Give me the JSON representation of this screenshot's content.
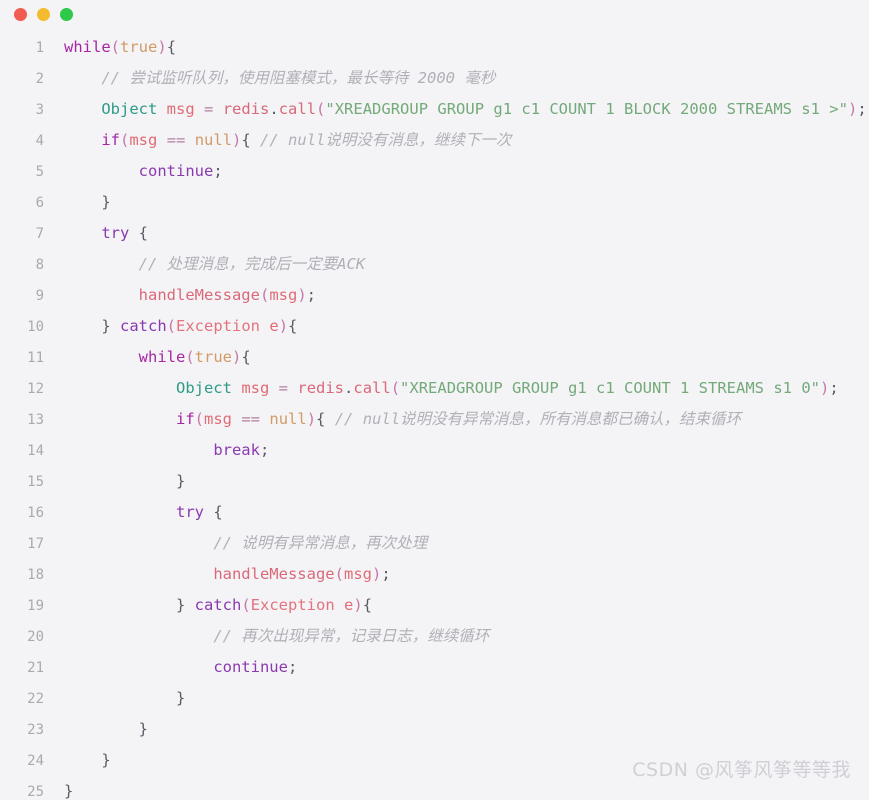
{
  "window": {
    "background_color": "#f4f4f6",
    "traffic_lights": [
      {
        "name": "close",
        "color": "#f05c51"
      },
      {
        "name": "minimize",
        "color": "#f5bb2e"
      },
      {
        "name": "maximize",
        "color": "#2ec84a"
      }
    ]
  },
  "watermark": {
    "text": "CSDN @风筝风筝等等我"
  },
  "code": {
    "language": "java",
    "line_numbers": [
      "1",
      "2",
      "3",
      "4",
      "5",
      "6",
      "7",
      "8",
      "9",
      "10",
      "11",
      "12",
      "13",
      "14",
      "15",
      "16",
      "17",
      "18",
      "19",
      "20",
      "21",
      "22",
      "23",
      "24",
      "25"
    ],
    "lines": [
      {
        "n": "1",
        "text": "while(true){"
      },
      {
        "n": "2",
        "text": "    // 尝试监听队列，使用阻塞模式，最长等待 2000 毫秒"
      },
      {
        "n": "3",
        "text": "    Object msg = redis.call(\"XREADGROUP GROUP g1 c1 COUNT 1 BLOCK 2000 STREAMS s1 >\");"
      },
      {
        "n": "4",
        "text": "    if(msg == null){ // null说明没有消息，继续下一次"
      },
      {
        "n": "5",
        "text": "        continue;"
      },
      {
        "n": "6",
        "text": "    }"
      },
      {
        "n": "7",
        "text": "    try {"
      },
      {
        "n": "8",
        "text": "        // 处理消息，完成后一定要ACK"
      },
      {
        "n": "9",
        "text": "        handleMessage(msg);"
      },
      {
        "n": "10",
        "text": "    } catch(Exception e){"
      },
      {
        "n": "11",
        "text": "        while(true){"
      },
      {
        "n": "12",
        "text": "            Object msg = redis.call(\"XREADGROUP GROUP g1 c1 COUNT 1 STREAMS s1 0\");"
      },
      {
        "n": "13",
        "text": "            if(msg == null){ // null说明没有异常消息，所有消息都已确认，结束循环"
      },
      {
        "n": "14",
        "text": "                break;"
      },
      {
        "n": "15",
        "text": "            }"
      },
      {
        "n": "16",
        "text": "            try {"
      },
      {
        "n": "17",
        "text": "                // 说明有异常消息，再次处理"
      },
      {
        "n": "18",
        "text": "                handleMessage(msg);"
      },
      {
        "n": "19",
        "text": "            } catch(Exception e){"
      },
      {
        "n": "20",
        "text": "                // 再次出现异常，记录日志，继续循环"
      },
      {
        "n": "21",
        "text": "                continue;"
      },
      {
        "n": "22",
        "text": "            }"
      },
      {
        "n": "23",
        "text": "        }"
      },
      {
        "n": "24",
        "text": "    }"
      },
      {
        "n": "25",
        "text": "}"
      }
    ],
    "tokens": [
      [
        {
          "t": "while",
          "c": "t-kw"
        },
        {
          "t": "(",
          "c": "t-punc"
        },
        {
          "t": "true",
          "c": "t-const"
        },
        {
          "t": ")",
          "c": "t-punc"
        },
        {
          "t": "{",
          "c": "t-plain"
        }
      ],
      [
        {
          "t": "    ",
          "c": "t-plain"
        },
        {
          "t": "// 尝试监听队列，使用阻塞模式，最长等待 2000 毫秒",
          "c": "t-comment"
        }
      ],
      [
        {
          "t": "    ",
          "c": "t-plain"
        },
        {
          "t": "Object",
          "c": "t-type"
        },
        {
          "t": " ",
          "c": "t-plain"
        },
        {
          "t": "msg",
          "c": "t-var"
        },
        {
          "t": " ",
          "c": "t-plain"
        },
        {
          "t": "=",
          "c": "t-op"
        },
        {
          "t": " ",
          "c": "t-plain"
        },
        {
          "t": "redis",
          "c": "t-fn"
        },
        {
          "t": ".",
          "c": "t-plain"
        },
        {
          "t": "call",
          "c": "t-fn"
        },
        {
          "t": "(",
          "c": "t-punc"
        },
        {
          "t": "\"XREADGROUP GROUP g1 c1 COUNT 1 BLOCK 2000 STREAMS s1 >\"",
          "c": "t-str"
        },
        {
          "t": ")",
          "c": "t-punc"
        },
        {
          "t": ";",
          "c": "t-plain"
        }
      ],
      [
        {
          "t": "    ",
          "c": "t-plain"
        },
        {
          "t": "if",
          "c": "t-kw"
        },
        {
          "t": "(",
          "c": "t-punc"
        },
        {
          "t": "msg",
          "c": "t-var"
        },
        {
          "t": " ",
          "c": "t-plain"
        },
        {
          "t": "==",
          "c": "t-op"
        },
        {
          "t": " ",
          "c": "t-plain"
        },
        {
          "t": "null",
          "c": "t-const"
        },
        {
          "t": ")",
          "c": "t-punc"
        },
        {
          "t": "{ ",
          "c": "t-plain"
        },
        {
          "t": "// null说明没有消息，继续下一次",
          "c": "t-comment"
        }
      ],
      [
        {
          "t": "        ",
          "c": "t-plain"
        },
        {
          "t": "continue",
          "c": "t-kw2"
        },
        {
          "t": ";",
          "c": "t-plain"
        }
      ],
      [
        {
          "t": "    }",
          "c": "t-plain"
        }
      ],
      [
        {
          "t": "    ",
          "c": "t-plain"
        },
        {
          "t": "try",
          "c": "t-kw2"
        },
        {
          "t": " {",
          "c": "t-plain"
        }
      ],
      [
        {
          "t": "        ",
          "c": "t-plain"
        },
        {
          "t": "// 处理消息，完成后一定要ACK",
          "c": "t-comment"
        }
      ],
      [
        {
          "t": "        ",
          "c": "t-plain"
        },
        {
          "t": "handleMessage",
          "c": "t-fn"
        },
        {
          "t": "(",
          "c": "t-punc"
        },
        {
          "t": "msg",
          "c": "t-var"
        },
        {
          "t": ")",
          "c": "t-punc"
        },
        {
          "t": ";",
          "c": "t-plain"
        }
      ],
      [
        {
          "t": "    } ",
          "c": "t-plain"
        },
        {
          "t": "catch",
          "c": "t-kw2"
        },
        {
          "t": "(",
          "c": "t-punc"
        },
        {
          "t": "Exception",
          "c": "t-cls"
        },
        {
          "t": " ",
          "c": "t-plain"
        },
        {
          "t": "e",
          "c": "t-var"
        },
        {
          "t": ")",
          "c": "t-punc"
        },
        {
          "t": "{",
          "c": "t-plain"
        }
      ],
      [
        {
          "t": "        ",
          "c": "t-plain"
        },
        {
          "t": "while",
          "c": "t-kw"
        },
        {
          "t": "(",
          "c": "t-punc"
        },
        {
          "t": "true",
          "c": "t-const"
        },
        {
          "t": ")",
          "c": "t-punc"
        },
        {
          "t": "{",
          "c": "t-plain"
        }
      ],
      [
        {
          "t": "            ",
          "c": "t-plain"
        },
        {
          "t": "Object",
          "c": "t-type"
        },
        {
          "t": " ",
          "c": "t-plain"
        },
        {
          "t": "msg",
          "c": "t-var"
        },
        {
          "t": " ",
          "c": "t-plain"
        },
        {
          "t": "=",
          "c": "t-op"
        },
        {
          "t": " ",
          "c": "t-plain"
        },
        {
          "t": "redis",
          "c": "t-fn"
        },
        {
          "t": ".",
          "c": "t-plain"
        },
        {
          "t": "call",
          "c": "t-fn"
        },
        {
          "t": "(",
          "c": "t-punc"
        },
        {
          "t": "\"XREADGROUP GROUP g1 c1 COUNT 1 STREAMS s1 0\"",
          "c": "t-str"
        },
        {
          "t": ")",
          "c": "t-punc"
        },
        {
          "t": ";",
          "c": "t-plain"
        }
      ],
      [
        {
          "t": "            ",
          "c": "t-plain"
        },
        {
          "t": "if",
          "c": "t-kw"
        },
        {
          "t": "(",
          "c": "t-punc"
        },
        {
          "t": "msg",
          "c": "t-var"
        },
        {
          "t": " ",
          "c": "t-plain"
        },
        {
          "t": "==",
          "c": "t-op"
        },
        {
          "t": " ",
          "c": "t-plain"
        },
        {
          "t": "null",
          "c": "t-const"
        },
        {
          "t": ")",
          "c": "t-punc"
        },
        {
          "t": "{ ",
          "c": "t-plain"
        },
        {
          "t": "// null说明没有异常消息，所有消息都已确认，结束循环",
          "c": "t-comment"
        }
      ],
      [
        {
          "t": "                ",
          "c": "t-plain"
        },
        {
          "t": "break",
          "c": "t-kw2"
        },
        {
          "t": ";",
          "c": "t-plain"
        }
      ],
      [
        {
          "t": "            }",
          "c": "t-plain"
        }
      ],
      [
        {
          "t": "            ",
          "c": "t-plain"
        },
        {
          "t": "try",
          "c": "t-kw2"
        },
        {
          "t": " {",
          "c": "t-plain"
        }
      ],
      [
        {
          "t": "                ",
          "c": "t-plain"
        },
        {
          "t": "// 说明有异常消息，再次处理",
          "c": "t-comment"
        }
      ],
      [
        {
          "t": "                ",
          "c": "t-plain"
        },
        {
          "t": "handleMessage",
          "c": "t-fn"
        },
        {
          "t": "(",
          "c": "t-punc"
        },
        {
          "t": "msg",
          "c": "t-var"
        },
        {
          "t": ")",
          "c": "t-punc"
        },
        {
          "t": ";",
          "c": "t-plain"
        }
      ],
      [
        {
          "t": "            } ",
          "c": "t-plain"
        },
        {
          "t": "catch",
          "c": "t-kw2"
        },
        {
          "t": "(",
          "c": "t-punc"
        },
        {
          "t": "Exception",
          "c": "t-cls"
        },
        {
          "t": " ",
          "c": "t-plain"
        },
        {
          "t": "e",
          "c": "t-var"
        },
        {
          "t": ")",
          "c": "t-punc"
        },
        {
          "t": "{",
          "c": "t-plain"
        }
      ],
      [
        {
          "t": "                ",
          "c": "t-plain"
        },
        {
          "t": "// 再次出现异常，记录日志，继续循环",
          "c": "t-comment"
        }
      ],
      [
        {
          "t": "                ",
          "c": "t-plain"
        },
        {
          "t": "continue",
          "c": "t-kw2"
        },
        {
          "t": ";",
          "c": "t-plain"
        }
      ],
      [
        {
          "t": "            }",
          "c": "t-plain"
        }
      ],
      [
        {
          "t": "        }",
          "c": "t-plain"
        }
      ],
      [
        {
          "t": "    }",
          "c": "t-plain"
        }
      ],
      [
        {
          "t": "}",
          "c": "t-plain"
        }
      ]
    ]
  }
}
